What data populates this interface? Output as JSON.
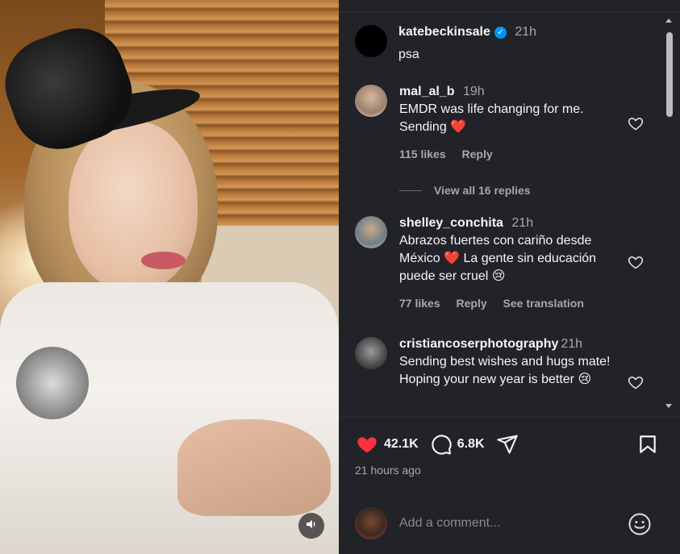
{
  "post": {
    "owner": "katebeckinsale",
    "time": "21h",
    "caption": "psa",
    "likes": "42.1K",
    "comments_count": "6.8K",
    "posted_ago": "21 hours ago"
  },
  "comments": [
    {
      "username": "mal_al_b",
      "time": "19h",
      "text": "EMDR was life changing for me. Sending ❤️",
      "likes": "115 likes",
      "reply": "Reply",
      "view_replies": "View all 16 replies"
    },
    {
      "username": "shelley_conchita",
      "time": "21h",
      "text": "Abrazos fuertes con cariño desde México ❤️ La gente sin educación puede ser cruel 😢",
      "likes": "77 likes",
      "reply": "Reply",
      "see_translation": "See translation"
    },
    {
      "username": "cristiancoserphotography",
      "time": "21h",
      "text": "Sending best wishes and hugs mate! Hoping your new year is better 😢"
    }
  ],
  "comment_box": {
    "placeholder": "Add a comment..."
  },
  "colors": {
    "panel_bg": "#212328",
    "like_red": "#ff3040",
    "verified_blue": "#0095f6",
    "secondary_text": "#a8a8a8"
  },
  "icons": {
    "volume": "speaker-icon",
    "like": "heart-icon",
    "comment": "speech-bubble-icon",
    "share": "paper-plane-icon",
    "save": "bookmark-icon",
    "emoji": "smiley-icon"
  }
}
